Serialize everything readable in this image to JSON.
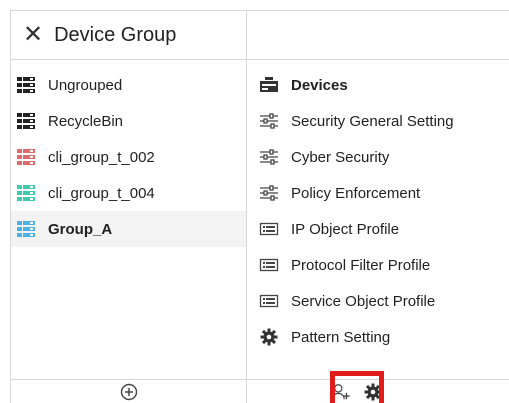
{
  "header": {
    "title": "Device Group",
    "close_icon": "close-icon"
  },
  "groups": [
    {
      "label": "Ungrouped",
      "color": "#222222",
      "active": false
    },
    {
      "label": "RecycleBin",
      "color": "#222222",
      "active": false
    },
    {
      "label": "cli_group_t_002",
      "color": "#e06a6a",
      "active": false
    },
    {
      "label": "cli_group_t_004",
      "color": "#3ecbb0",
      "active": false
    },
    {
      "label": "Group_A",
      "color": "#4ab1e8",
      "active": true
    }
  ],
  "menu": [
    {
      "label": "Devices",
      "icon": "devices-icon"
    },
    {
      "label": "Security General Setting",
      "icon": "sliders-icon"
    },
    {
      "label": "Cyber Security",
      "icon": "sliders-icon"
    },
    {
      "label": "Policy Enforcement",
      "icon": "sliders-icon"
    },
    {
      "label": "IP Object Profile",
      "icon": "list-card-icon"
    },
    {
      "label": "Protocol Filter Profile",
      "icon": "list-card-icon"
    },
    {
      "label": "Service Object Profile",
      "icon": "list-card-icon"
    },
    {
      "label": "Pattern Setting",
      "icon": "gear-icon"
    }
  ],
  "footer": {
    "left_icon": "add-circle-icon",
    "right_icons": [
      "add-user-icon",
      "gear-icon"
    ],
    "highlight_color": "#e21b1b"
  }
}
